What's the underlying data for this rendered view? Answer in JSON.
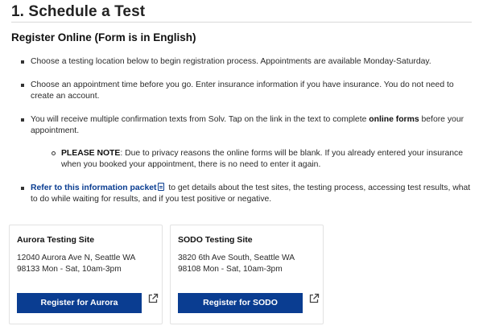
{
  "page": {
    "title": "1. Schedule a Test",
    "section_heading": "Register Online (Form is in English)"
  },
  "bullets": {
    "item1": "Choose a testing location below to begin registration process. Appointments are available Monday-Saturday.",
    "item2": "Choose an appointment time before you go. Enter insurance information if you have insurance. You do not need to create an account.",
    "item3_before": "You will receive multiple confirmation texts from Solv. Tap on the link in the text to complete ",
    "item3_bold": "online forms",
    "item3_after": " before your appointment.",
    "note_label": "PLEASE NOTE",
    "note_text": ": Due to privacy reasons the online forms will be blank.  If you already entered your insurance when you booked your appointment, there is no need to enter it again.",
    "item4_link": "Refer to this information packet",
    "item4_after": " to get details about the test sites, the testing process, accessing test results, what to do while waiting for results, and if you test positive or negative."
  },
  "sites": {
    "aurora": {
      "name": "Aurora Testing Site",
      "address": "12040 Aurora Ave N, Seattle WA 98133 Mon - Sat, 10am-3pm",
      "button": "Register for Aurora"
    },
    "sodo": {
      "name": "SODO Testing Site",
      "address": "3820 6th Ave South, Seattle WA 98108 Mon - Sat, 10am-3pm",
      "button": "Register for SODO"
    }
  },
  "icons": {
    "document": "document-icon",
    "external_link": "external-link-icon"
  },
  "colors": {
    "accent": "#0a3d91",
    "text": "#2a2a2a",
    "rule": "#d9d9d9"
  }
}
